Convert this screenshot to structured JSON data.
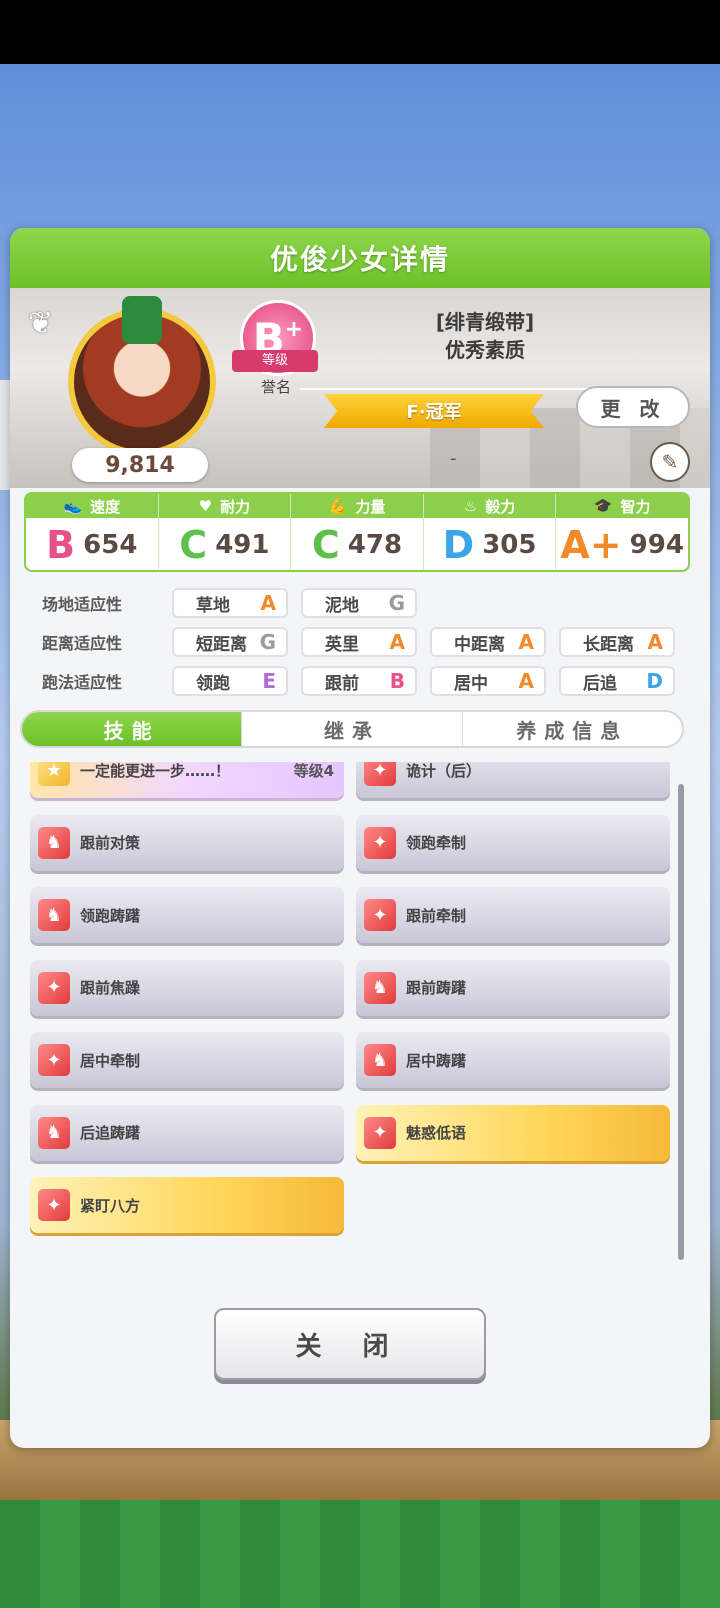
{
  "panel_title": "优俊少女详情",
  "profile": {
    "score": "9,814",
    "rank_letter": "B",
    "rank_plus": "+",
    "rank_ribbon": "等级",
    "rank_sub": "誉名",
    "epithet_line1": "[绯青缎带]",
    "epithet_line2": "优秀素质",
    "title": "F·冠军",
    "change_label": "更 改",
    "subtitle": "-"
  },
  "stats": [
    {
      "label": "速度",
      "icon": "shoe-icon",
      "grade": "B",
      "value": "654",
      "color": "#e8508a"
    },
    {
      "label": "耐力",
      "icon": "heart-icon",
      "grade": "C",
      "value": "491",
      "color": "#5cc04a"
    },
    {
      "label": "力量",
      "icon": "arm-icon",
      "grade": "C",
      "value": "478",
      "color": "#5cc04a"
    },
    {
      "label": "毅力",
      "icon": "flame-icon",
      "grade": "D",
      "value": "305",
      "color": "#3aa6e8"
    },
    {
      "label": "智力",
      "icon": "cap-icon",
      "grade": "A+",
      "value": "994",
      "color": "#f08a2a"
    }
  ],
  "aptitudes": [
    {
      "label": "场地适应性",
      "cells": [
        {
          "name": "草地",
          "grade": "A",
          "color": "#f08a2a"
        },
        {
          "name": "泥地",
          "grade": "G",
          "color": "#9a9aa0"
        }
      ]
    },
    {
      "label": "距离适应性",
      "cells": [
        {
          "name": "短距离",
          "grade": "G",
          "color": "#9a9aa0"
        },
        {
          "name": "英里",
          "grade": "A",
          "color": "#f08a2a"
        },
        {
          "name": "中距离",
          "grade": "A",
          "color": "#f08a2a"
        },
        {
          "name": "长距离",
          "grade": "A",
          "color": "#f08a2a"
        }
      ]
    },
    {
      "label": "跑法适应性",
      "cells": [
        {
          "name": "领跑",
          "grade": "E",
          "color": "#b06ad8"
        },
        {
          "name": "跟前",
          "grade": "B",
          "color": "#e8508a"
        },
        {
          "name": "居中",
          "grade": "A",
          "color": "#f08a2a"
        },
        {
          "name": "后追",
          "grade": "D",
          "color": "#3aa6e8"
        }
      ]
    }
  ],
  "tabs": [
    "技能",
    "继承",
    "养成信息"
  ],
  "skills": [
    {
      "name": "一定能更进一步……！",
      "level": "等级4",
      "style": "rainbow",
      "icon": "star-icon"
    },
    {
      "name": "诡计（后）",
      "level": "",
      "style": "normal",
      "icon": "sparkle-icon"
    },
    {
      "name": "跟前对策",
      "level": "",
      "style": "normal",
      "icon": "horse-icon"
    },
    {
      "name": "领跑牵制",
      "level": "",
      "style": "normal",
      "icon": "sparkle-icon"
    },
    {
      "name": "领跑踌躇",
      "level": "",
      "style": "normal",
      "icon": "horse-icon"
    },
    {
      "name": "跟前牵制",
      "level": "",
      "style": "normal",
      "icon": "sparkle-icon"
    },
    {
      "name": "跟前焦躁",
      "level": "",
      "style": "normal",
      "icon": "sparkle-icon"
    },
    {
      "name": "跟前踌躇",
      "level": "",
      "style": "normal",
      "icon": "horse-icon"
    },
    {
      "name": "居中牵制",
      "level": "",
      "style": "normal",
      "icon": "sparkle-icon"
    },
    {
      "name": "居中踌躇",
      "level": "",
      "style": "normal",
      "icon": "horse-icon"
    },
    {
      "name": "后追踌躇",
      "level": "",
      "style": "normal",
      "icon": "horse-icon"
    },
    {
      "name": "魅惑低语",
      "level": "",
      "style": "gold",
      "icon": "sparkle-icon"
    },
    {
      "name": "紧盯八方",
      "level": "",
      "style": "gold",
      "icon": "sparkle-icon"
    }
  ],
  "close_label": "关 闭"
}
